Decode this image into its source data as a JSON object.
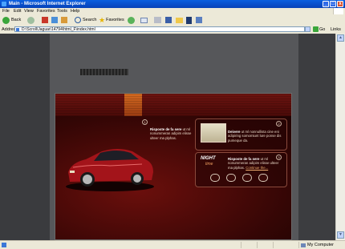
{
  "window": {
    "title": "Main - Microsoft Internet Explorer",
    "controls": [
      "_",
      "□",
      "x"
    ]
  },
  "menu": [
    "File",
    "Edit",
    "View",
    "Favorites",
    "Tools",
    "Help"
  ],
  "toolbar": {
    "back": "Back",
    "search": "Search",
    "favorites": "Favorites"
  },
  "address": {
    "label": "Address",
    "value": "D:\\Scroll\\Jaguar\\14794\\html_F\\index.html",
    "go": "Go",
    "links": "Links"
  },
  "site": {
    "panel1_bold": "Risposte de fa sere",
    "panel1_text": "ut ml nonummeran adipim elisse ulteer ma plphas.",
    "panel2_bold": "Deivere",
    "panel2_text": "ut ml nonnullista cine eni adipiring somomiunt lure ponse dis pumeque da.",
    "panel3_bold": "Risposte de fa sere",
    "panel3_text": "ut ml nonummeran adipim elisse ulteer ma plphas.",
    "panel3_link": "Continue the...",
    "night_title": "NIGHT",
    "night_sub": "time",
    "num1": "1",
    "num2": "2",
    "num3": "3"
  },
  "status": {
    "zone": "My Computer"
  }
}
